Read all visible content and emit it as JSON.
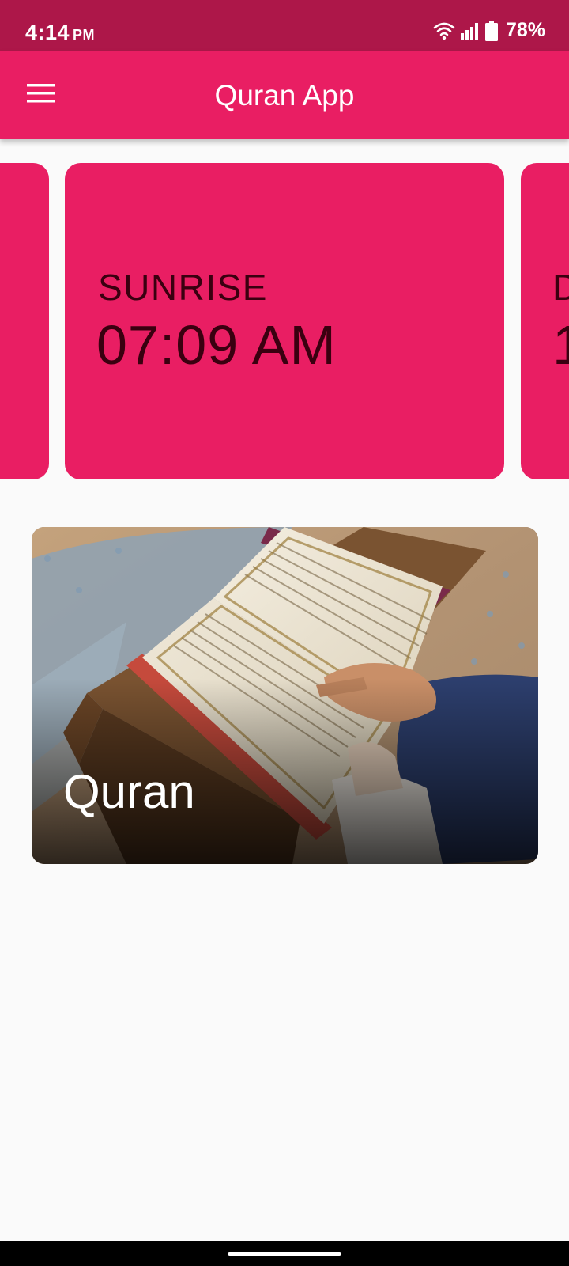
{
  "status_bar": {
    "time": "4:14",
    "ampm": "PM",
    "battery": "78%",
    "icons": [
      "wifi-icon",
      "signal-icon",
      "battery-icon"
    ]
  },
  "app_bar": {
    "title": "Quran App",
    "menu_icon": "hamburger-menu-icon",
    "color": "#e91e63"
  },
  "prayer_times": {
    "current": {
      "label": "SUNRISE",
      "time": "07:09 AM"
    },
    "next_peek": {
      "label": "D",
      "time": "1"
    }
  },
  "feature_cards": [
    {
      "label": "Quran",
      "image": "open Quran book on wooden stand"
    }
  ],
  "colors": {
    "status_bar": "#ad1749",
    "primary": "#e91e63",
    "card_text": "#3a0010",
    "background": "#fafafa"
  }
}
